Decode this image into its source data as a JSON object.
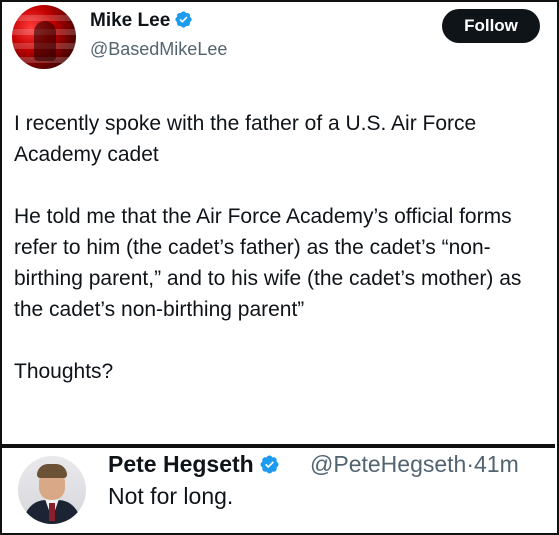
{
  "tweet": {
    "author_name": "Mike Lee",
    "author_handle": "@BasedMikeLee",
    "follow_label": "Follow",
    "paragraphs": [
      "I recently spoke with the father of a U.S. Air Force Academy cadet",
      "He told me that the Air Force Academy’s official forms refer to him (the cadet’s father) as the cadet’s “non-birthing parent,” and to his wife (the cadet’s mother) as the cadet’s non-birthing parent”",
      "Thoughts?"
    ]
  },
  "reply": {
    "author_name": "Pete Hegseth",
    "author_handle": "@PeteHegseth",
    "separator": "·",
    "time": "41m",
    "text": "Not for long."
  },
  "colors": {
    "verified": "#1d9bf0",
    "button_bg": "#0f1419",
    "secondary_text": "#536471"
  },
  "icons": {
    "verified": "verified-badge-icon"
  }
}
